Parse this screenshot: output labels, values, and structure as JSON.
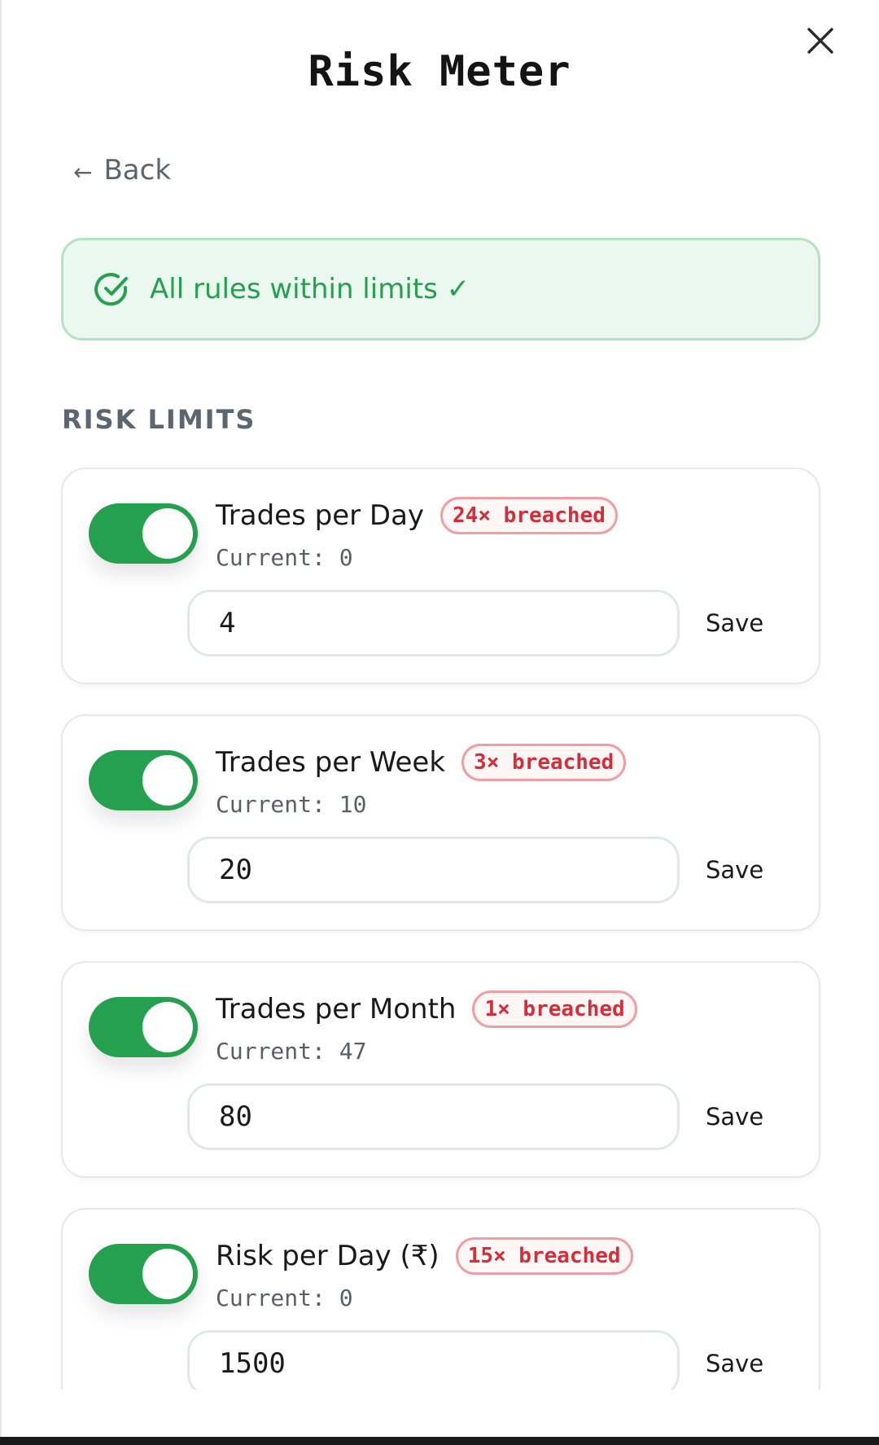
{
  "header": {
    "title": "Risk Meter",
    "close_icon": "close-icon"
  },
  "navigation": {
    "back_label": "Back",
    "back_icon": "left-arrow-icon",
    "back_arrow_glyph": "←"
  },
  "status": {
    "text": "All rules within limits ✓",
    "icon": "check-circle-icon",
    "color": "#24a04e"
  },
  "section": {
    "heading": "RISK LIMITS"
  },
  "rules": [
    {
      "label": "Trades per Day",
      "badge": "24× breached",
      "current": "Current: 0",
      "value": "4",
      "enabled": true,
      "save_label": "Save"
    },
    {
      "label": "Trades per Week",
      "badge": "3× breached",
      "current": "Current: 10",
      "value": "20",
      "enabled": true,
      "save_label": "Save"
    },
    {
      "label": "Trades per Month",
      "badge": "1× breached",
      "current": "Current: 47",
      "value": "80",
      "enabled": true,
      "save_label": "Save"
    },
    {
      "label": "Risk per Day (₹)",
      "badge": "15× breached",
      "current": "Current: 0",
      "value": "1500",
      "enabled": true,
      "save_label": "Save"
    }
  ],
  "colors": {
    "accent_green": "#24a04e",
    "badge_red": "#d42e3a",
    "banner_bg": "#ebf8ef"
  }
}
